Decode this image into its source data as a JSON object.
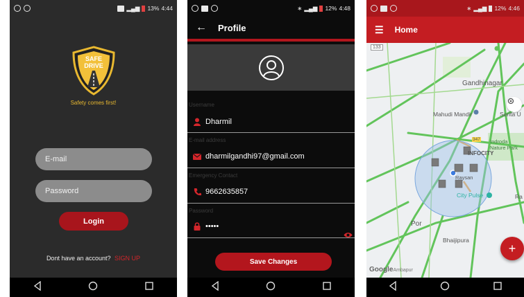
{
  "login_screen": {
    "status_time": "4:44",
    "status_battery": "13%",
    "logo_line1": "SAFE",
    "logo_line2": "DRIVE",
    "tagline": "Safety comes first!",
    "email_placeholder": "E-mail",
    "password_placeholder": "Password",
    "login_label": "Login",
    "signup_prompt": "Dont have an account?",
    "signup_link": "SIGN UP"
  },
  "profile_screen": {
    "status_time": "4:48",
    "status_battery": "12%",
    "title": "Profile",
    "back_glyph": "←",
    "fields": [
      {
        "label": "Username",
        "value": "Dharmil",
        "icon": "person-icon"
      },
      {
        "label": "E-mail address",
        "value": "dharmilgandhi97@gmail.com",
        "icon": "mail-icon"
      },
      {
        "label": "Emergency Contact",
        "value": "9662635857",
        "icon": "phone-icon"
      },
      {
        "label": "Password",
        "value": "•••••",
        "icon": "lock-icon"
      }
    ],
    "save_label": "Save Changes"
  },
  "home_screen": {
    "status_time": "4:46",
    "status_battery": "12%",
    "title": "Home",
    "fab_glyph": "+",
    "map_labels": {
      "gandhinagar": "Gandhinagar",
      "mahudi_mandir": "Mahudi Mandir",
      "sarita": "Sarita U",
      "infocity": "INFOCITY",
      "indroda1": "Indroda",
      "indroda2": "Nature Park",
      "road_347": "347",
      "city_pulse": "City Pulse",
      "por": "Por",
      "bhaijipura": "Bhaijipura",
      "raysan": "Raysan",
      "ra": "Ra",
      "road_133": "133",
      "google": "Google",
      "ambapur": "Ambapur"
    }
  },
  "colors": {
    "brand_red": "#b3161d",
    "accent_yellow": "#e8b830",
    "traffic_green": "#62c45b"
  }
}
